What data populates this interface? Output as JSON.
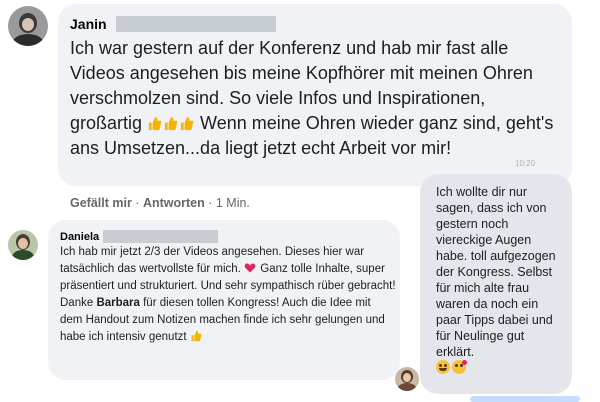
{
  "comment1": {
    "author": "Janin",
    "text_part1": "Ich war gestern auf der Konferenz und hab mir fast alle Videos angesehen bis meine Kopfhörer mit meinen Ohren verschmolzen sind. So viele Infos und Inspirationen, großartig",
    "text_part2": " Wenn meine Ohren wieder ganz sind, geht's ans Umsetzen...da liegt jetzt echt Arbeit vor mir!",
    "like": "Gefällt mir",
    "separator1": " · ",
    "reply": "Antworten",
    "separator2": " · ",
    "time": "1 Min."
  },
  "comment2": {
    "author": "Daniela",
    "text_part1": "Ich hab mir jetzt 2/3 der Videos angesehen. Dieses hier war tatsächlich das wertvollste für mich.",
    "text_part2": " Ganz tolle Inhalte, super präsentiert und strukturiert. Und sehr sympathisch rüber gebracht! Danke ",
    "mention": "Barbara",
    "text_part3": " für diesen tollen Kongress! Auch die Idee mit dem Handout zum Notizen machen finde ich sehr gelungen und habe ich intensiv genutzt"
  },
  "message": {
    "timestamp": "10:20",
    "text": "Ich wollte dir nur sagen, dass ich von gestern noch viereckige Augen habe. toll aufgezogen der Kongress. Selbst für mich alte frau waren da noch ein paar Tipps dabei und für Neulinge gut erklärt."
  },
  "icons": {
    "thumb": "thumbs-up-emoji",
    "heart": "heart-emoji",
    "wink": "winking-face-emoji",
    "kiss": "face-blowing-kiss-emoji"
  },
  "colors": {
    "bubble": "#f0f2f5",
    "message_bubble": "#e4e6eb",
    "thumb": "#f5b400",
    "heart": "#e0245e"
  }
}
